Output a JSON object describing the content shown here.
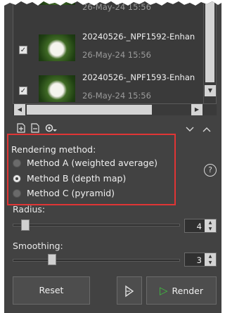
{
  "files": [
    {
      "name": "",
      "date": "26-May-24 15:56",
      "checked": true
    },
    {
      "name": "20240526-_NPF1592-Enhan",
      "date": "26-May-24 15:56",
      "checked": true
    },
    {
      "name": "20240526-_NPF1593-Enhan",
      "date": "26-May-24 15:56",
      "checked": true
    }
  ],
  "rendering": {
    "label": "Rendering method:",
    "options": [
      {
        "label": "Method A (weighted average)",
        "selected": false
      },
      {
        "label": "Method B (depth map)",
        "selected": true
      },
      {
        "label": "Method C (pyramid)",
        "selected": false
      }
    ],
    "help_symbol": "?"
  },
  "radius": {
    "label": "Radius:",
    "value": "4",
    "slider_fraction": 0.04
  },
  "smoothing": {
    "label": "Smoothing:",
    "value": "3",
    "slider_fraction": 0.22
  },
  "buttons": {
    "reset": "Reset",
    "render": "Render"
  },
  "icons": {
    "toolbar": [
      "add-file-icon",
      "remove-file-icon",
      "settings-icon"
    ],
    "collapse": [
      "chevron-down-icon",
      "chevron-up-icon"
    ]
  },
  "colors": {
    "highlight_box": "#e03535",
    "render_arrow": "#3fbf3f"
  }
}
